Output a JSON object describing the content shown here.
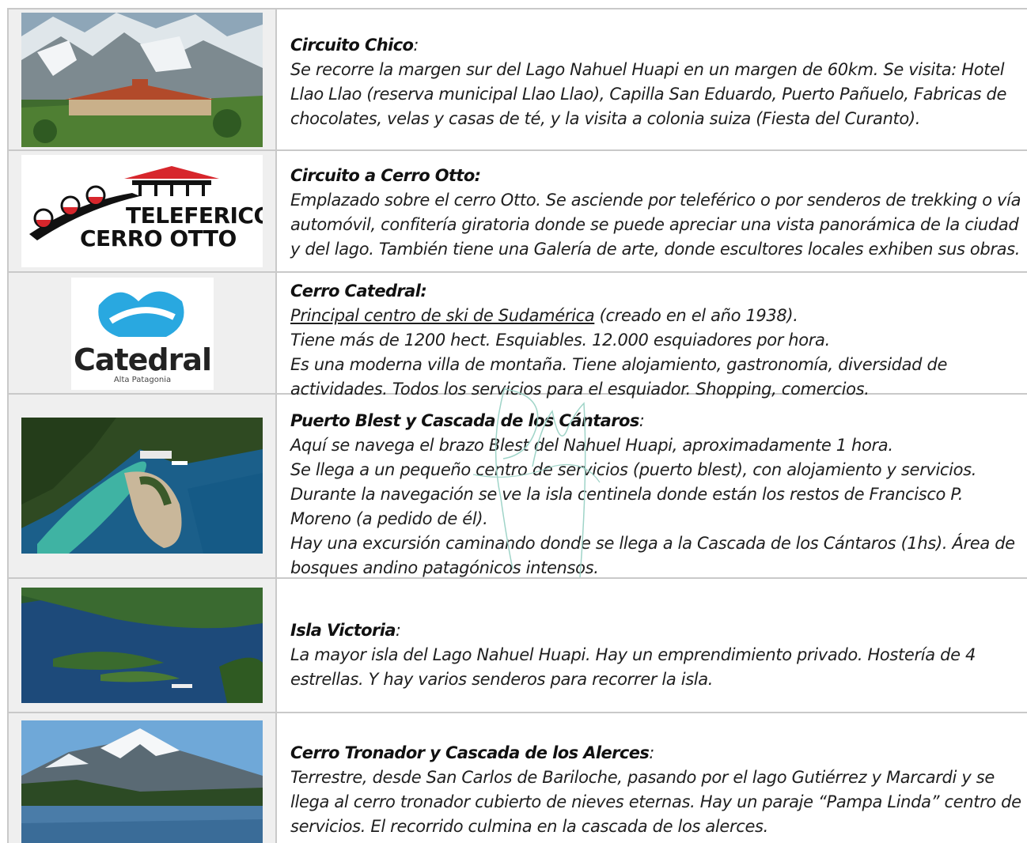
{
  "rows": [
    {
      "image": "hotel-llao-llao-photo",
      "title": "Circuito Chico",
      "title_suffix": ":",
      "paragraphs": [
        "Se recorre la margen sur del Lago Nahuel Huapi en un margen de 60km. Se visita: Hotel Llao Llao (reserva municipal Llao Llao), Capilla San Eduardo, Puerto Pañuelo, Fabricas de chocolates, velas y casas de té, y la visita a colonia suiza (Fiesta del Curanto)."
      ]
    },
    {
      "image": "teleferico-cerro-otto-logo",
      "logo_line1": "TELEFERICO",
      "logo_line2": "CERRO OTTO",
      "title": "Circuito a Cerro Otto:",
      "paragraphs": [
        "Emplazado sobre el cerro Otto. Se asciende por teleférico o por senderos de trekking o vía automóvil, confitería giratoria donde se puede apreciar una vista panorámica de la ciudad y del lago. También tiene una Galería de arte, donde escultores locales exhiben sus obras."
      ]
    },
    {
      "image": "catedral-logo",
      "logo_name": "Catedral",
      "logo_sub": "Alta Patagonia",
      "title": "Cerro Catedral:",
      "underlined": "Principal centro de ski de Sudamérica",
      "underlined_rest": " (creado en el año 1938).",
      "paragraphs": [
        "Tiene más de 1200 hect. Esquiables. 12.000 esquiadores por hora.",
        "Es una moderna villa de montaña. Tiene alojamiento, gastronomía, diversidad de actividades. Todos los servicios para el esquiador. Shopping, comercios."
      ]
    },
    {
      "image": "puerto-blest-photo",
      "title": "Puerto Blest y Cascada de los Cántaros",
      "title_suffix": ":",
      "paragraphs": [
        "Aquí se navega el brazo Blest del Nahuel Huapi, aproximadamente 1 hora.",
        "Se llega a un pequeño centro de servicios (puerto blest), con alojamiento y servicios.",
        "Durante la navegación se ve la isla centinela donde están los restos de Francisco P. Moreno (a pedido de él).",
        "Hay una excursión caminando donde se llega a la Cascada de los Cántaros (1hs). Área de bosques andino patagónicos intensos."
      ]
    },
    {
      "image": "isla-victoria-photo",
      "title": "Isla Victoria",
      "title_suffix": ":",
      "paragraphs": [
        "La mayor isla del Lago Nahuel Huapi. Hay un emprendimiento privado. Hostería de 4 estrellas. Y hay varios senderos para recorrer la isla."
      ]
    },
    {
      "image": "cerro-tronador-photo",
      "title": "Cerro Tronador y Cascada de los Alerces",
      "title_suffix": ":",
      "paragraphs": [
        "Terrestre, desde San Carlos de Bariloche, pasando por el lago Gutiérrez y Marcardi y se llega al cerro tronador cubierto de nieves eternas. Hay un paraje “Pampa Linda” centro de servicios. El recorrido culmina en la cascada de los alerces."
      ]
    }
  ],
  "colors": {
    "border": "#c9c9c9",
    "image_cell_bg": "#efefef",
    "text": "#1e1e1e",
    "logo_red": "#d7262c",
    "catedral_blue": "#29a8e0"
  }
}
